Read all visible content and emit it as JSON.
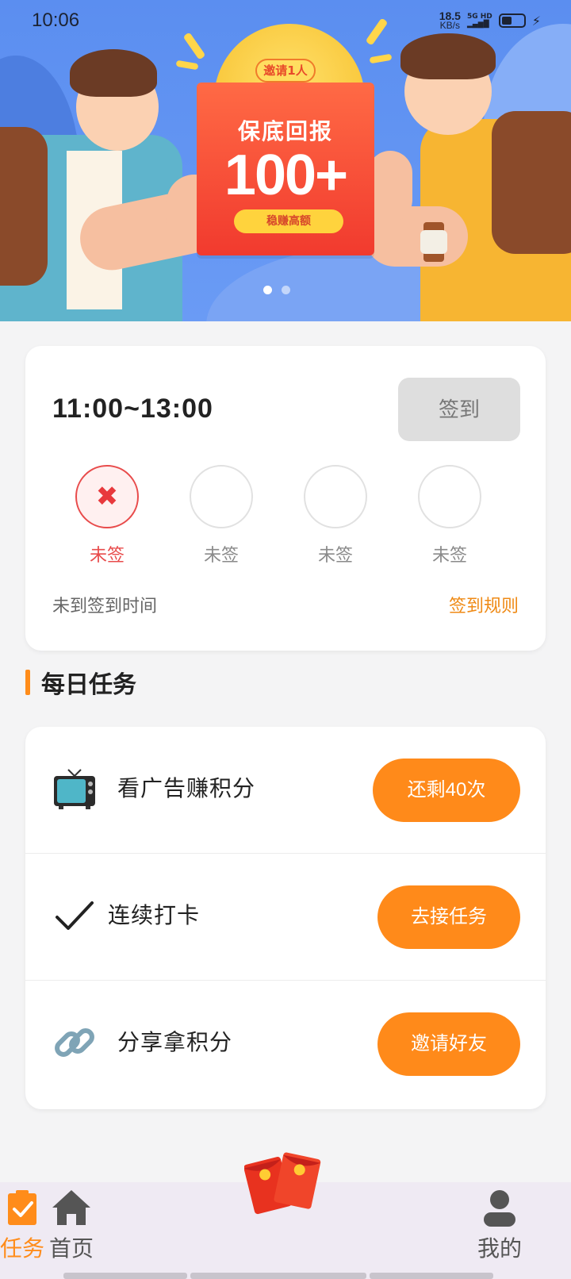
{
  "status_bar": {
    "time": "10:06",
    "net_speed_value": "18.5",
    "net_speed_unit": "KB/s",
    "signal_label": "5G HD"
  },
  "banner": {
    "invite_tag": "邀请1人",
    "card_title": "保底回报",
    "card_amount": "100+",
    "card_pill": "稳赚高额",
    "pages": 2,
    "active_page": 1
  },
  "signin": {
    "time_range": "11:00~13:00",
    "button_label": "签到",
    "slots": [
      {
        "label": "未签",
        "state": "missed"
      },
      {
        "label": "未签",
        "state": "pending"
      },
      {
        "label": "未签",
        "state": "pending"
      },
      {
        "label": "未签",
        "state": "pending"
      }
    ],
    "status_text": "未到签到时间",
    "rules_link": "签到规则"
  },
  "daily_tasks": {
    "title": "每日任务",
    "items": [
      {
        "icon": "tv-icon",
        "label": "看广告赚积分",
        "button": "还剩40次"
      },
      {
        "icon": "checkmark-icon",
        "label": "连续打卡",
        "button": "去接任务"
      },
      {
        "icon": "link-icon",
        "label": "分享拿积分",
        "button": "邀请好友"
      }
    ]
  },
  "tabbar": {
    "items": [
      {
        "icon": "home-icon",
        "label": "首页",
        "active": false
      },
      {
        "icon": "clipboard-check-icon",
        "label": "任务",
        "active": true
      },
      {
        "icon": "user-icon",
        "label": "我的",
        "active": false
      }
    ]
  },
  "colors": {
    "accent": "#ff8a1a",
    "missed": "#e84b4b",
    "banner_bg": "#5b8ef0"
  }
}
